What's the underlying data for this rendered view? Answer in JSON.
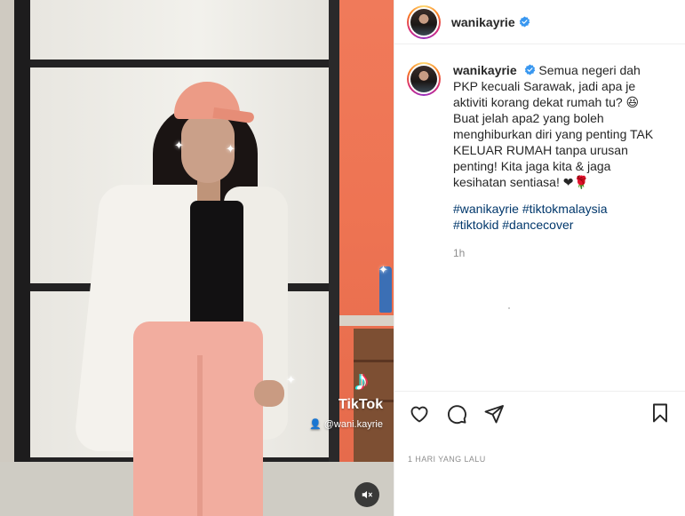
{
  "post": {
    "username": "wanikayrie",
    "verified": true,
    "caption": "Semua negeri dah PKP kecuali Sarawak, jadi apa je aktiviti korang dekat rumah tu? 😆 Buat jelah apa2 yang boleh menghiburkan diri yang penting TAK KELUAR RUMAH tanpa urusan penting! Kita jaga kita & jaga kesihatan sentiasa! ❤🌹",
    "hashtags": [
      "#wanikayrie",
      "#tiktokmalaysia",
      "#tiktokid",
      "#dancecover"
    ],
    "relative_time": "1h",
    "date_label": "1 HARI YANG LALU"
  },
  "video": {
    "tiktok_brand": "TikTok",
    "tiktok_handle": "@wani.kayrie",
    "muted": true
  },
  "icons": {
    "header_avatar": "avatar",
    "verified_badge": "verified-badge-icon",
    "like": "heart-icon",
    "comment": "comment-icon",
    "share": "paper-plane-icon",
    "save": "bookmark-icon",
    "mute": "speaker-muted-icon",
    "tiktok_logo": "tiktok-note-icon"
  },
  "colors": {
    "verified_blue": "#3897f0",
    "hashtag": "#00376b",
    "secondary_text": "#8e8e8e",
    "divider": "#efefef"
  }
}
